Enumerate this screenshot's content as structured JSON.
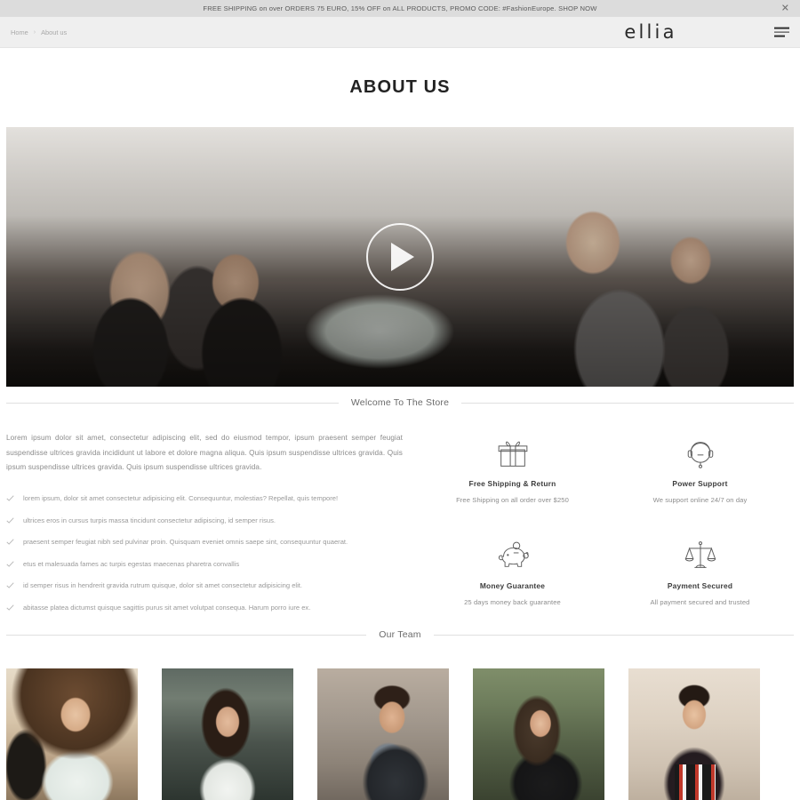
{
  "promo": {
    "text": "FREE SHIPPING on over ORDERS 75 EURO, 15% OFF on ALL PRODUCTS, PROMO CODE: #FashionEurope. SHOP NOW",
    "close_icon": "close-icon",
    "close_glyph": "✕",
    "background": "#dcdcdc"
  },
  "header": {
    "breadcrumb": [
      {
        "label": "Home"
      },
      {
        "label": "About us"
      }
    ],
    "breadcrumb_separator": "›",
    "logo": "ellia",
    "menu_icon": "hamburger-menu-icon",
    "background": "#efefef"
  },
  "page": {
    "title": "ABOUT US"
  },
  "hero": {
    "alt": "team working at a table in an office",
    "play_icon": "play-icon"
  },
  "welcome": {
    "heading": "Welcome To The Store",
    "paragraph": "Lorem ipsum dolor sit amet, consectetur adipiscing elit, sed do eiusmod tempor, ipsum praesent semper feugiat suspendisse ultrices gravida incididunt ut labore et dolore magna aliqua. Quis ipsum suspendisse ultrices gravida. Quis ipsum suspendisse ultrices gravida. Quis ipsum suspendisse ultrices gravida.",
    "check_icon": "check-icon",
    "checklist": [
      "lorem ipsum, dolor sit amet consectetur adipisicing elit. Consequuntur, molestias? Repellat, quis tempore!",
      "ultrices eros in cursus turpis massa tincidunt consectetur adipiscing, id semper risus.",
      "praesent semper feugiat nibh sed pulvinar proin. Quisquam eveniet omnis saepe sint, consequuntur quaerat.",
      "etus et malesuada fames ac turpis egestas maecenas pharetra convallis",
      "id semper risus in hendrerit gravida rutrum quisque, dolor sit amet consectetur adipisicing elit.",
      "abitasse platea dictumst quisque sagittis purus sit amet volutpat consequa. Harum porro iure ex."
    ]
  },
  "features": [
    {
      "icon": "gift-box-icon",
      "title": "Free Shipping & Return",
      "subtitle": "Free Shipping on all order over $250"
    },
    {
      "icon": "headset-support-icon",
      "title": "Power Support",
      "subtitle": "We support online 24/7 on day"
    },
    {
      "icon": "piggy-bank-icon",
      "title": "Money Guarantee",
      "subtitle": "25 days money back guarantee"
    },
    {
      "icon": "scales-balance-icon",
      "title": "Payment Secured",
      "subtitle": "All payment secured and trusted"
    }
  ],
  "team": {
    "heading": "Our Team",
    "members": [
      {
        "alt": "smiling man in white t-shirt"
      },
      {
        "alt": "woman in white ringer tee"
      },
      {
        "alt": "bearded man in black jacket"
      },
      {
        "alt": "woman in black jacket outdoors"
      },
      {
        "alt": "young man in striped shirt"
      }
    ]
  },
  "colors": {
    "promo_bg": "#dcdcdc",
    "header_bg": "#efefef",
    "text_dark": "#222222",
    "text_muted": "#8d8d8d",
    "rule": "#e0e0e0"
  }
}
